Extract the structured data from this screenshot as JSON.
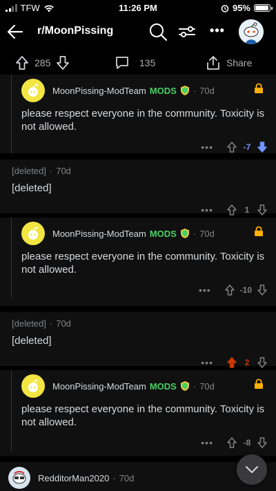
{
  "status_bar": {
    "carrier": "TFW",
    "time": "11:26 PM",
    "battery_percent": "95%",
    "battery_level": 0.95
  },
  "header": {
    "subreddit": "r/MoonPissing"
  },
  "post_actions": {
    "upvotes": "285",
    "comments": "135",
    "share_label": "Share"
  },
  "comments": [
    {
      "author": "MoonPissing-ModTeam",
      "badge": "MODS",
      "age": "70d",
      "body": "please respect everyone in the community. Toxicity is not allowed.",
      "score": "-7",
      "vote": "down"
    },
    {
      "author": "[deleted]",
      "age": "70d",
      "body": "[deleted]",
      "score": "1",
      "vote": "none"
    },
    {
      "author": "MoonPissing-ModTeam",
      "badge": "MODS",
      "age": "70d",
      "body": "please respect everyone in the community. Toxicity is not allowed.",
      "score": "-10",
      "vote": "none"
    },
    {
      "author": "[deleted]",
      "age": "70d",
      "body": "[deleted]",
      "score": "2",
      "vote": "up"
    },
    {
      "author": "MoonPissing-ModTeam",
      "badge": "MODS",
      "age": "70d",
      "body": "please respect everyone in the community. Toxicity is not allowed.",
      "score": "-8",
      "vote": "none"
    },
    {
      "author": "RedditorMan2020",
      "age": "70d"
    }
  ],
  "colors": {
    "downvote": "#7193ff",
    "upvote": "#cc3700",
    "mods": "#46d160",
    "lock": "#ffb000"
  }
}
